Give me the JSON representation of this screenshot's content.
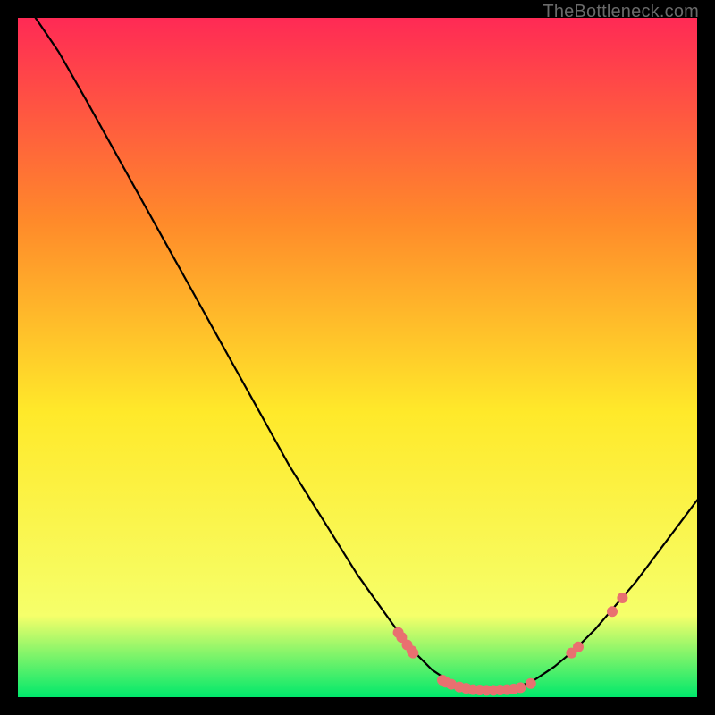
{
  "watermark": "TheBottleneck.com",
  "chart_data": {
    "type": "line",
    "title": "",
    "xlabel": "",
    "ylabel": "",
    "xlim": [
      0,
      100
    ],
    "ylim": [
      0,
      100
    ],
    "background_gradient": {
      "top": "#ff2a55",
      "mid_upper": "#ff8a2a",
      "mid": "#ffe92a",
      "lower": "#f6ff6a",
      "bottom": "#00e86b"
    },
    "curve": {
      "name": "bottleneck-curve",
      "description": "V-shaped penalty curve: steep decrease from upper-left, bottoming out ~x=63-75, then rising toward right edge",
      "points": [
        {
          "x": 2.6,
          "y": 100
        },
        {
          "x": 6,
          "y": 95
        },
        {
          "x": 10,
          "y": 88
        },
        {
          "x": 15,
          "y": 79
        },
        {
          "x": 20,
          "y": 70
        },
        {
          "x": 25,
          "y": 61
        },
        {
          "x": 30,
          "y": 52
        },
        {
          "x": 35,
          "y": 43
        },
        {
          "x": 40,
          "y": 34
        },
        {
          "x": 45,
          "y": 26
        },
        {
          "x": 50,
          "y": 18
        },
        {
          "x": 55,
          "y": 11
        },
        {
          "x": 58,
          "y": 7
        },
        {
          "x": 61,
          "y": 4
        },
        {
          "x": 64,
          "y": 2
        },
        {
          "x": 67,
          "y": 1
        },
        {
          "x": 70,
          "y": 1
        },
        {
          "x": 73,
          "y": 1.2
        },
        {
          "x": 76,
          "y": 2.5
        },
        {
          "x": 79,
          "y": 4.5
        },
        {
          "x": 82,
          "y": 7
        },
        {
          "x": 85,
          "y": 10
        },
        {
          "x": 88,
          "y": 13.5
        },
        {
          "x": 91,
          "y": 17
        },
        {
          "x": 94,
          "y": 21
        },
        {
          "x": 97,
          "y": 25
        },
        {
          "x": 100,
          "y": 29
        }
      ]
    },
    "markers": {
      "color": "#e97070",
      "radius": 6,
      "clusters": [
        {
          "name": "left-descent-cluster",
          "points": [
            {
              "x": 56,
              "y": 9.5
            },
            {
              "x": 56.5,
              "y": 8.8
            },
            {
              "x": 57.3,
              "y": 7.7
            },
            {
              "x": 58.0,
              "y": 6.8
            },
            {
              "x": 58.2,
              "y": 6.5
            }
          ]
        },
        {
          "name": "bottom-flat-cluster",
          "points": [
            {
              "x": 62.5,
              "y": 2.5
            },
            {
              "x": 63.0,
              "y": 2.2
            },
            {
              "x": 63.8,
              "y": 1.9
            },
            {
              "x": 65.0,
              "y": 1.5
            },
            {
              "x": 66.0,
              "y": 1.3
            },
            {
              "x": 67.0,
              "y": 1.1
            },
            {
              "x": 68.0,
              "y": 1.05
            },
            {
              "x": 69.0,
              "y": 1.0
            },
            {
              "x": 70.0,
              "y": 1.0
            },
            {
              "x": 71.0,
              "y": 1.05
            },
            {
              "x": 72.0,
              "y": 1.1
            },
            {
              "x": 73.0,
              "y": 1.2
            },
            {
              "x": 74.0,
              "y": 1.4
            },
            {
              "x": 75.5,
              "y": 2.0
            }
          ]
        },
        {
          "name": "right-ascent-cluster-1",
          "points": [
            {
              "x": 81.5,
              "y": 6.5
            },
            {
              "x": 82.5,
              "y": 7.4
            }
          ]
        },
        {
          "name": "right-ascent-cluster-2",
          "points": [
            {
              "x": 87.5,
              "y": 12.6
            },
            {
              "x": 89.0,
              "y": 14.6
            }
          ]
        }
      ]
    }
  }
}
